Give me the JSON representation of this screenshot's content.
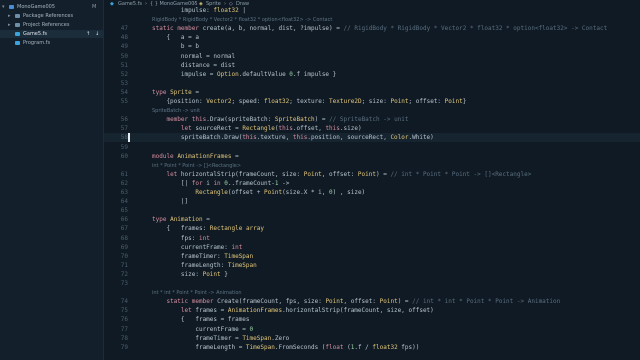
{
  "sidebar": {
    "project": "MonoGame005",
    "vcs_badge": "M",
    "items": [
      {
        "label": "MonoGame005",
        "icon": "project-icon",
        "expanded": true
      },
      {
        "label": "Package References",
        "icon": "package-icon"
      },
      {
        "label": "Project References",
        "icon": "reference-icon"
      },
      {
        "label": "Game5.fs",
        "icon": "fsharp-file-icon",
        "selected": true
      },
      {
        "label": "Program.fs",
        "icon": "fsharp-file-icon"
      }
    ],
    "move_up": "↑",
    "move_down": "↓"
  },
  "breadcrumb": {
    "file": "Game5.fs",
    "namespace": "{ } MonoGame005",
    "type": "Sprite",
    "member": "Draw"
  },
  "editor": {
    "current_line": "58",
    "lines": [
      {
        "n": "",
        "lens": "",
        "text": "        impulse: float32 |"
      },
      {
        "n": "",
        "lens": "RigidBody * RigidBody * Vector2 * float32 * option<float32> -> Contact",
        "text": ""
      },
      {
        "n": "47",
        "text": "static member create(a, b, normal, dist, ?impulse) = // RigidBody * RigidBody * Vector2 * float32 * option<float32> -> Contact"
      },
      {
        "n": "48",
        "text": "    {   a = a"
      },
      {
        "n": "49",
        "text": "        b = b"
      },
      {
        "n": "50",
        "text": "        normal = normal"
      },
      {
        "n": "51",
        "text": "        distance = dist"
      },
      {
        "n": "52",
        "text": "        impulse = Option.defaultValue 0.f impulse }"
      },
      {
        "n": "53",
        "text": ""
      },
      {
        "n": "54",
        "text": "type Sprite ="
      },
      {
        "n": "55",
        "text": "    {position: Vector2; speed: float32; texture: Texture2D; size: Point; offset: Point}"
      },
      {
        "n": "",
        "lens": "SpriteBatch -> unit",
        "text": ""
      },
      {
        "n": "56",
        "text": "    member this.Draw(spriteBatch: SpriteBatch) = // SpriteBatch -> unit"
      },
      {
        "n": "57",
        "text": "        let sourceRect = Rectangle(this.offset, this.size)"
      },
      {
        "n": "58",
        "text": "        spriteBatch.Draw(this.texture, this.position, sourceRect, Color.White)"
      },
      {
        "n": "59",
        "text": ""
      },
      {
        "n": "60",
        "text": "module AnimationFrames ="
      },
      {
        "n": "",
        "lens": "int * Point * Point -> []<Rectangle>",
        "text": ""
      },
      {
        "n": "61",
        "text": "    let horizontalStrip(frameCount, size: Point, offset: Point) = // int * Point * Point -> []<Rectangle>"
      },
      {
        "n": "62",
        "text": "        [| for i in 0..frameCount-1 ->"
      },
      {
        "n": "63",
        "text": "            Rectangle(offset + Point(size.X * i, 0) , size)"
      },
      {
        "n": "64",
        "text": "        |]"
      },
      {
        "n": "65",
        "text": ""
      },
      {
        "n": "66",
        "text": "type Animation ="
      },
      {
        "n": "67",
        "text": "    {   frames: Rectangle array"
      },
      {
        "n": "68",
        "text": "        fps: int"
      },
      {
        "n": "69",
        "text": "        currentFrame: int"
      },
      {
        "n": "70",
        "text": "        frameTimer: TimeSpan"
      },
      {
        "n": "71",
        "text": "        frameLength: TimeSpan"
      },
      {
        "n": "72",
        "text": "        size: Point }"
      },
      {
        "n": "73",
        "text": ""
      },
      {
        "n": "",
        "lens": "int * int * Point * Point -> Animation",
        "text": ""
      },
      {
        "n": "74",
        "text": "    static member Create(frameCount, fps, size: Point, offset: Point) = // int * int * Point * Point -> Animation"
      },
      {
        "n": "75",
        "text": "        let frames = AnimationFrames.horizontalStrip(frameCount, size, offset)"
      },
      {
        "n": "76",
        "text": "        {   frames = frames"
      },
      {
        "n": "77",
        "text": "            currentFrame = 0"
      },
      {
        "n": "78",
        "text": "            frameTimer = TimeSpan.Zero"
      },
      {
        "n": "79",
        "text": "            frameLength = TimeSpan.FromSeconds (float (1.f / float32 fps))"
      }
    ]
  }
}
